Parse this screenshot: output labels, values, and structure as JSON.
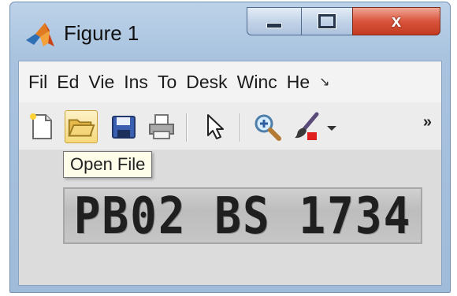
{
  "window": {
    "title": "Figure 1",
    "controls": {
      "close_label": "x"
    }
  },
  "menubar": {
    "items": [
      {
        "label": "Fil"
      },
      {
        "label": "Ed"
      },
      {
        "label": "Vie"
      },
      {
        "label": "Ins"
      },
      {
        "label": "To"
      },
      {
        "label": "Desk"
      },
      {
        "label": "Winc"
      },
      {
        "label": "He"
      }
    ],
    "chevron": "↘"
  },
  "toolbar": {
    "tools": [
      {
        "name": "new-figure-icon"
      },
      {
        "name": "open-file-icon",
        "pressed": true
      },
      {
        "name": "save-icon"
      },
      {
        "name": "print-icon"
      },
      {
        "name": "pointer-arrow-icon"
      },
      {
        "name": "zoom-in-icon"
      },
      {
        "name": "brush-icon"
      },
      {
        "name": "dropdown-caret-icon"
      }
    ],
    "overflow": "»"
  },
  "tooltip": {
    "text": "Open File"
  },
  "figure": {
    "plate_text": "PB02 BS 1734"
  },
  "colors": {
    "titlebar": "#bcd2e8",
    "close_button": "#d9543c",
    "tooltip_bg": "#fdfde9",
    "plate_bg": "#c6c6c6"
  }
}
